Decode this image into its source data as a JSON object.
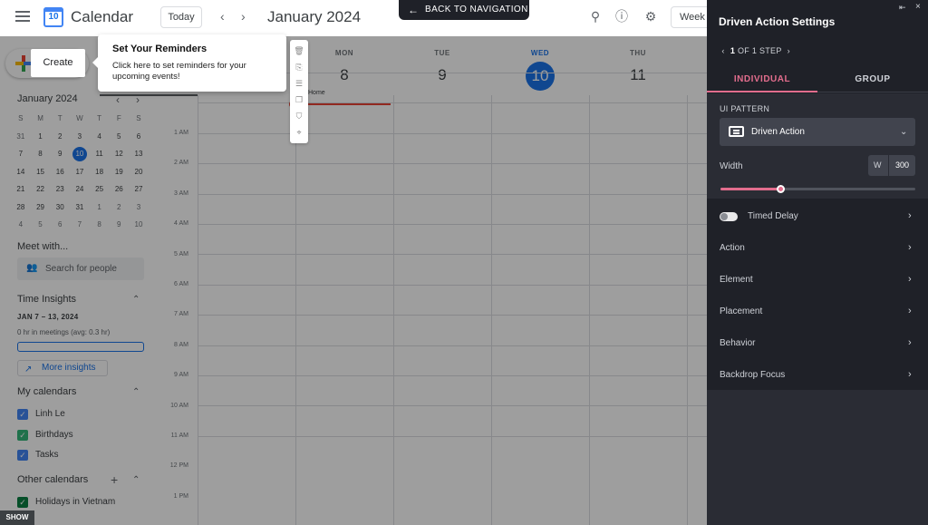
{
  "calendar": {
    "app_title": "Calendar",
    "logo_number": "10",
    "today_label": "Today",
    "month_label": "January 2024",
    "view_label": "Week",
    "create_label": "Create",
    "mini_calendar": {
      "title": "January 2024",
      "dow": [
        "S",
        "M",
        "T",
        "W",
        "T",
        "F",
        "S"
      ],
      "weeks": [
        [
          "31",
          "1",
          "2",
          "3",
          "4",
          "5",
          "6"
        ],
        [
          "7",
          "8",
          "9",
          "10",
          "11",
          "12",
          "13"
        ],
        [
          "14",
          "15",
          "16",
          "17",
          "18",
          "19",
          "20"
        ],
        [
          "21",
          "22",
          "23",
          "24",
          "25",
          "26",
          "27"
        ],
        [
          "28",
          "29",
          "30",
          "31",
          "1",
          "2",
          "3"
        ],
        [
          "4",
          "5",
          "6",
          "7",
          "8",
          "9",
          "10"
        ]
      ],
      "today": "10"
    },
    "meet_with": "Meet with...",
    "search_people_placeholder": "Search for people",
    "time_insights": {
      "title": "Time Insights",
      "range": "JAN 7 – 13, 2024",
      "meetings": "0 hr in meetings (avg: 0.3 hr)",
      "more_label": "More insights"
    },
    "my_calendars": {
      "title": "My calendars",
      "items": [
        {
          "name": "Linh Le",
          "color": "#4285f4"
        },
        {
          "name": "Birthdays",
          "color": "#33b679"
        },
        {
          "name": "Tasks",
          "color": "#4285f4"
        }
      ]
    },
    "other_calendars": {
      "title": "Other calendars",
      "items": [
        {
          "name": "Holidays in Vietnam",
          "color": "#0b8043"
        }
      ]
    },
    "days": [
      {
        "dow": "MON",
        "num": "8"
      },
      {
        "dow": "TUE",
        "num": "9"
      },
      {
        "dow": "WED",
        "num": "10",
        "today": true
      },
      {
        "dow": "THU",
        "num": "11"
      }
    ],
    "allday_event": "Home",
    "times": [
      "1 AM",
      "2 AM",
      "3 AM",
      "4 AM",
      "5 AM",
      "6 AM",
      "7 AM",
      "8 AM",
      "9 AM",
      "10 AM",
      "11 AM",
      "12 PM",
      "1 PM"
    ]
  },
  "overlay": {
    "back_nav_label": "BACK TO NAVIGATION",
    "tooltip_title": "Set Your Reminders",
    "tooltip_body": "Click here to set reminders for your upcoming events!",
    "show_label": "SHOW"
  },
  "panel": {
    "title": "Driven Action Settings",
    "step_current": "1",
    "step_text": "OF 1 STEP",
    "tabs": [
      "INDIVIDUAL",
      "GROUP"
    ],
    "ui_pattern_label": "UI PATTERN",
    "ui_pattern_value": "Driven Action",
    "width_label": "Width",
    "width_prefix": "W",
    "width_value": "300",
    "width_slider_fraction": 0.31,
    "timed_delay_label": "Timed Delay",
    "sections": [
      "Action",
      "Element",
      "Placement",
      "Behavior",
      "Backdrop Focus"
    ],
    "accent_color": "#e26d8d",
    "bg_color": "#1f2128"
  }
}
